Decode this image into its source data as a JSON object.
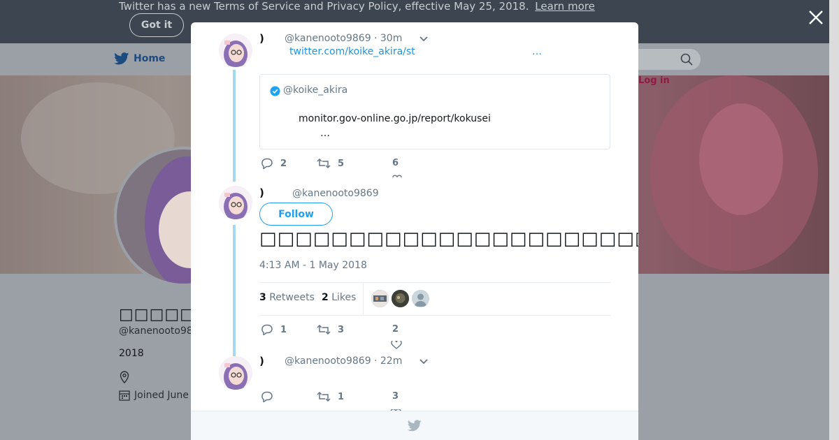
{
  "notice": {
    "text": "Twitter has a new Terms of Service and Privacy Policy, effective May 25, 2018.",
    "link": "Learn more",
    "button": "Got it"
  },
  "nav": {
    "home": "Home",
    "login": "Log in"
  },
  "profile": {
    "name": "□□□□□□□)",
    "handle": "@kanenooto98",
    "year": "2018",
    "joined": "Joined June"
  },
  "tweets": [
    {
      "name": ")",
      "handle": "@kanenooto9869",
      "time": "· 30m",
      "link": "twitter.com/koike_akira/st",
      "link_ellipsis": "…",
      "quote": {
        "handle": "@koike_akira",
        "text": "monitor.gov-online.go.jp/report/kokusei",
        "ellipsis": "…"
      },
      "replies": "2",
      "retweets": "5",
      "likes": "6"
    },
    {
      "name": ")",
      "handle": "@kanenooto9869",
      "follow": "Follow",
      "text": "□□□□□□□□□□□□□□□□□□□□□□□□□□□□□□□□□□□□□□□□□□□□□",
      "date": "4:13 AM - 1 May 2018",
      "retweet_count": "3",
      "retweet_label": "Retweets",
      "like_count": "2",
      "like_label": "Likes",
      "replies": "1",
      "retweets": "3",
      "likes": "2"
    },
    {
      "name": ")",
      "handle": "@kanenooto9869",
      "time": "· 22m",
      "replies": "",
      "retweets": "1",
      "likes": "3"
    }
  ],
  "colors": {
    "accent": "#1da1f2",
    "thread": "#a7d8f2",
    "muted": "#657786"
  }
}
